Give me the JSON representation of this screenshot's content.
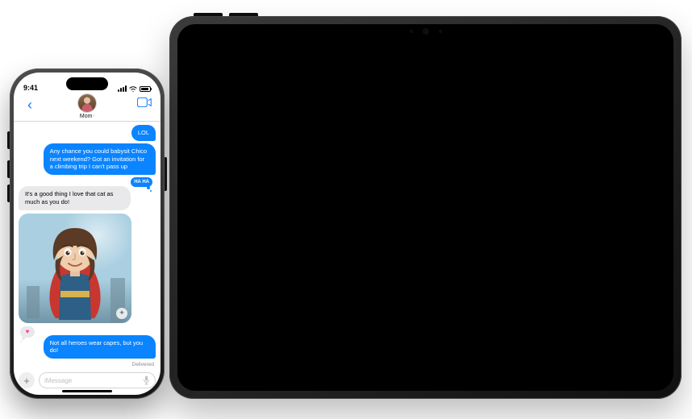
{
  "status": {
    "time": "9:41"
  },
  "nav": {
    "contact_name": "Mom"
  },
  "messages": {
    "m1_out": "LOL",
    "m2_out": "Any chance you could babysit Chico next weekend? Got an invitation for a climbing trip I can't pass up",
    "tapback_laugh": "HA HA",
    "m3_in": "It's a good thing I love that cat as much as you do!",
    "image_alt": "Generated image of a cartoon woman styled as a superhero wearing a red cape",
    "m4_out": "Not all heroes wear capes, but you do!",
    "delivered": "Delivered"
  },
  "compose": {
    "placeholder": "iMessage"
  },
  "colors": {
    "imessage_blue": "#0a84ff",
    "bubble_gray": "#e9e9eb",
    "ios_blue": "#0a7aff"
  }
}
